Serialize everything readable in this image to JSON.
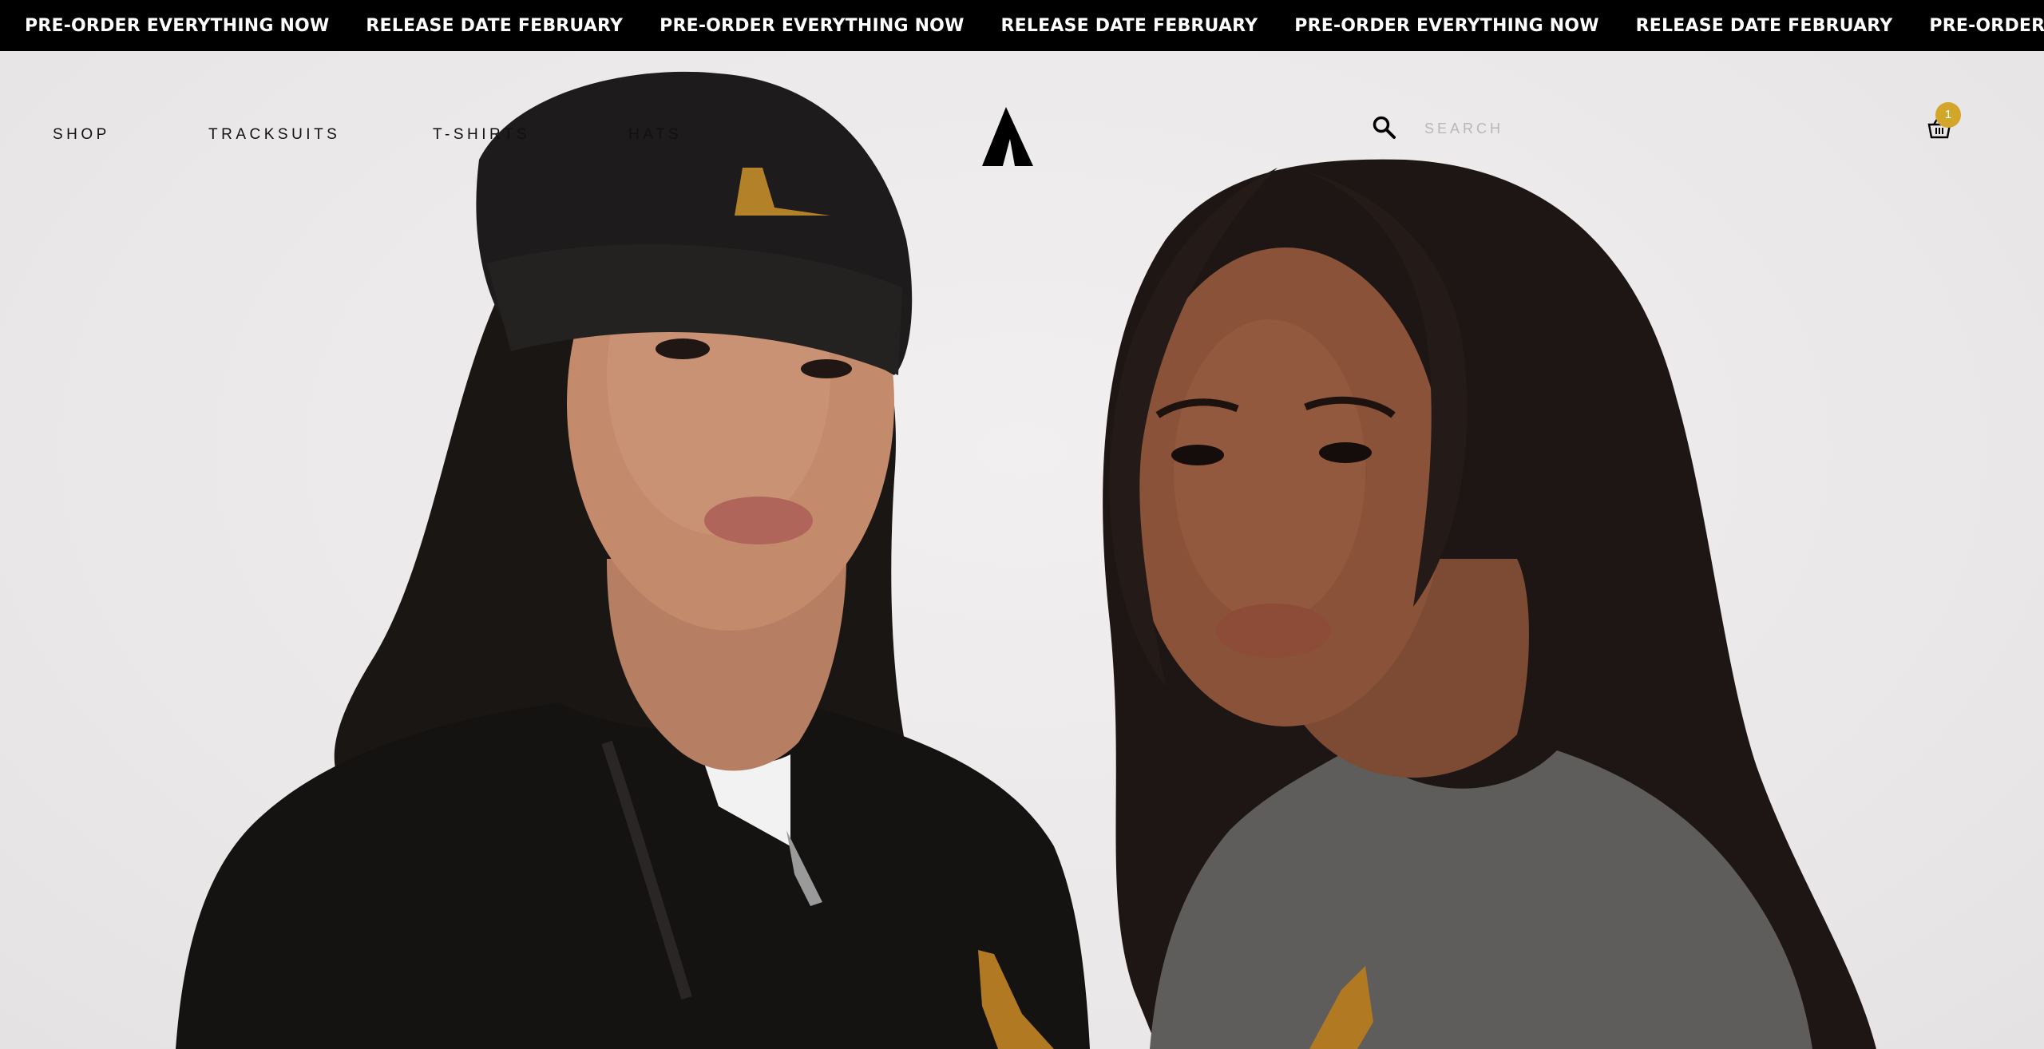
{
  "announcement": {
    "items": [
      "PRE-ORDER EVERYTHING NOW",
      "RELEASE DATE FEBRUARY",
      "PRE-ORDER EVERYTHING NOW",
      "RELEASE DATE FEBRUARY",
      "PRE-ORDER EVERYTHING NOW",
      "RELEASE DATE FEBRUARY",
      "PRE-ORDER EVERYTHING NOW"
    ]
  },
  "nav": {
    "shop": "SHOP",
    "tracksuits": "TRACKSUITS",
    "tshirts": "T-SHIRTS",
    "hats": "HATS"
  },
  "search": {
    "placeholder": "SEARCH",
    "value": ""
  },
  "cart": {
    "count": "1"
  },
  "icons": {
    "logo": "brand-peak-logo-icon",
    "search": "search-icon",
    "cart": "basket-icon"
  },
  "colors": {
    "ticker_bg": "#000000",
    "ticker_text": "#ffffff",
    "badge": "#d2a62a",
    "page_bg": "#eceaea"
  }
}
